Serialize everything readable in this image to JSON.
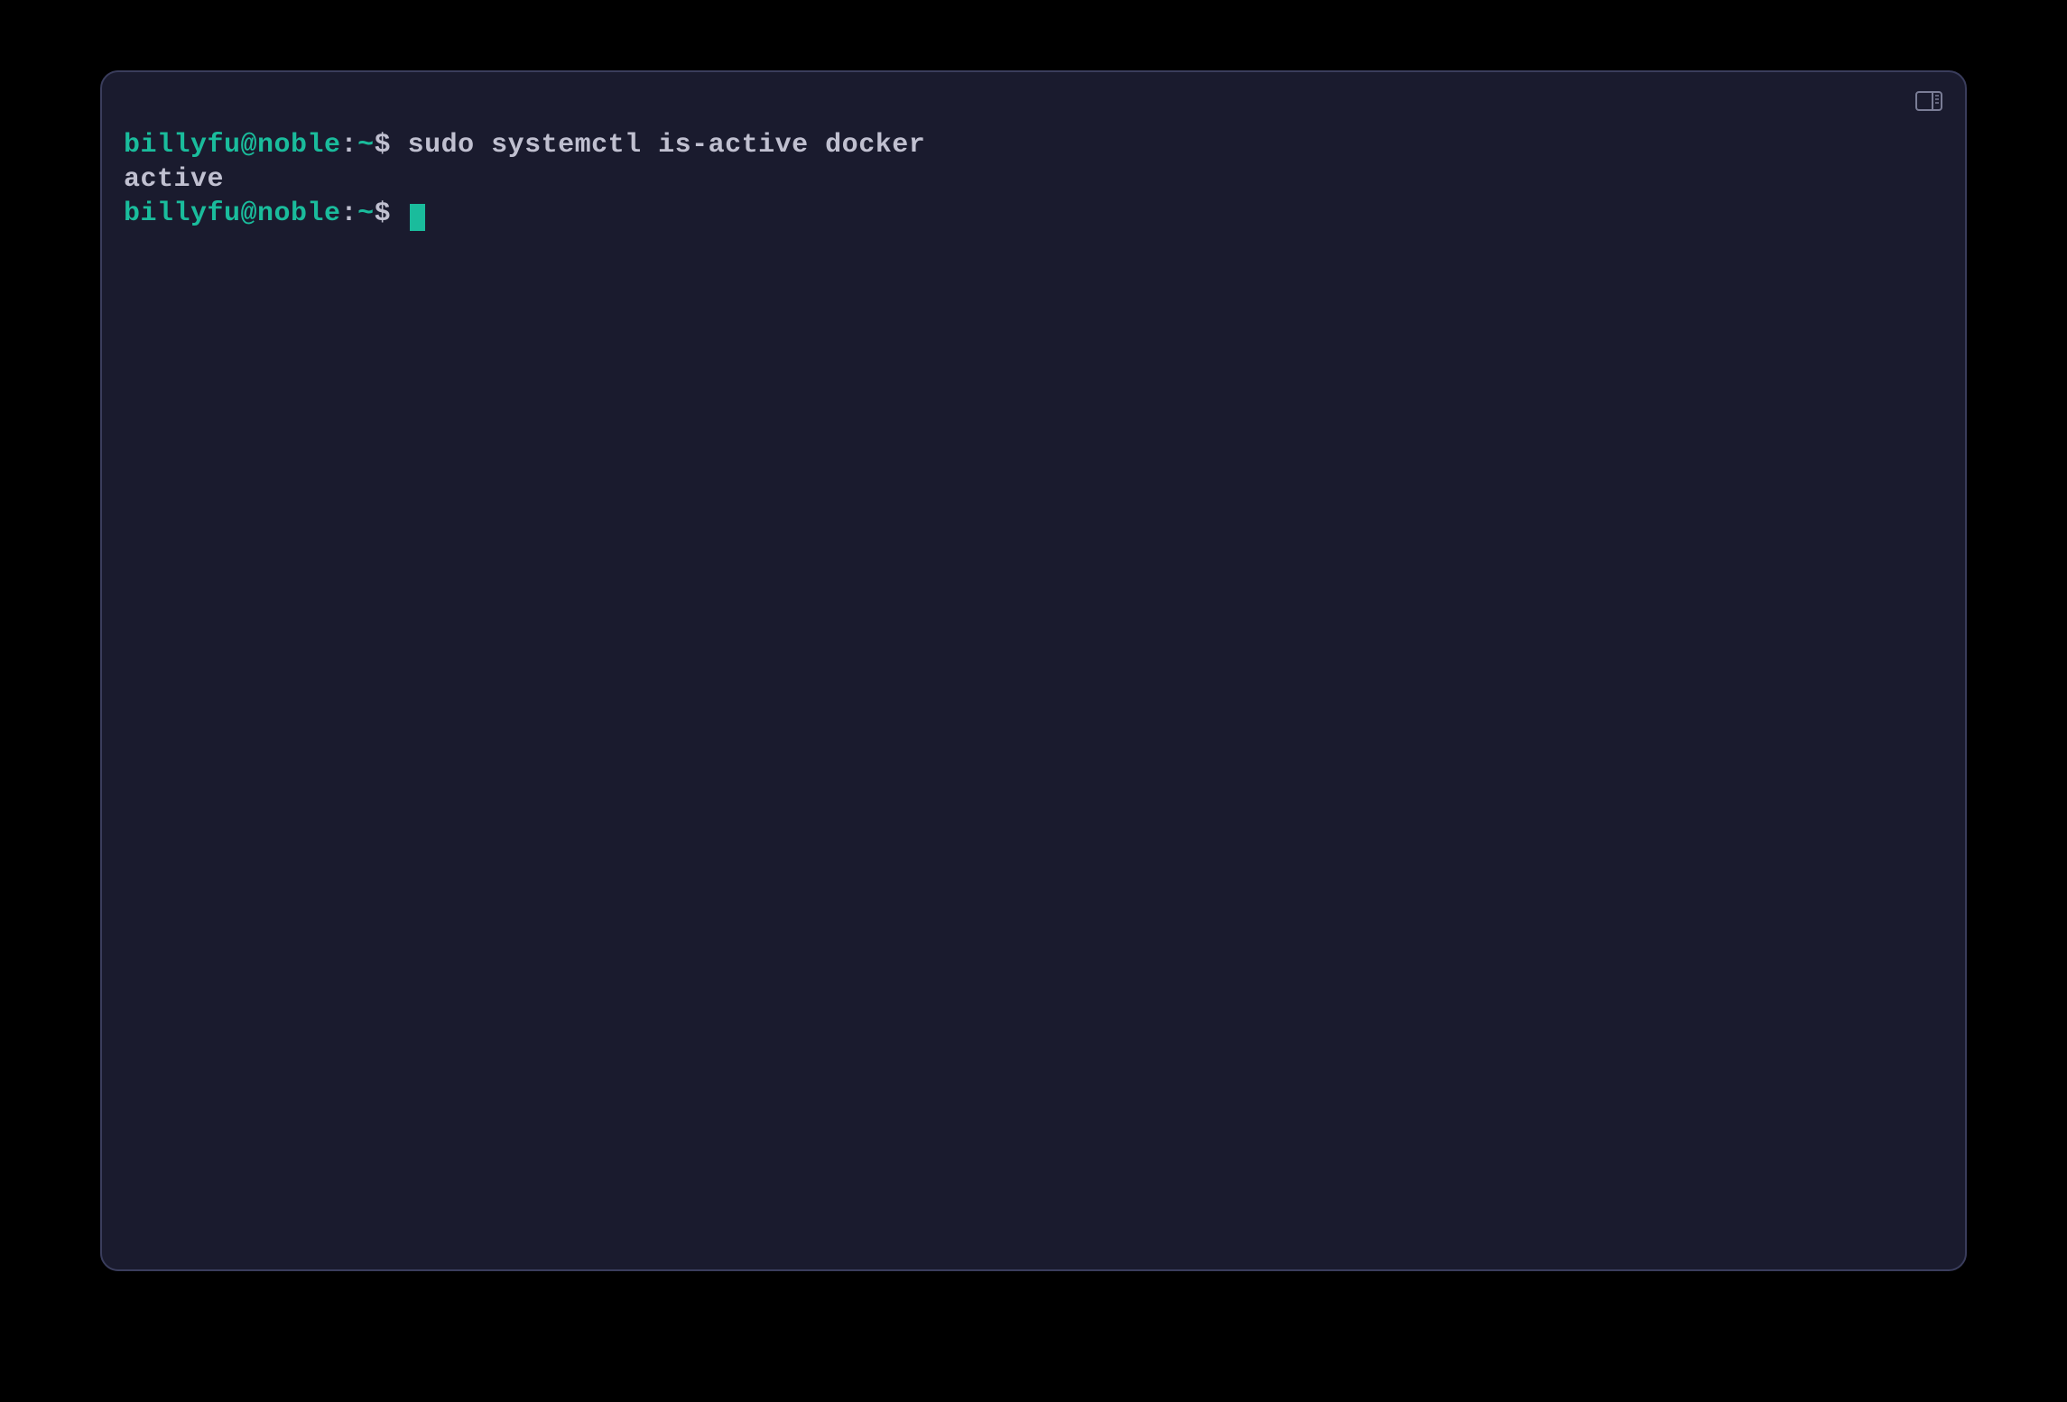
{
  "terminal": {
    "lines": [
      {
        "prompt": {
          "user_host": "billyfu@noble",
          "colon": ":",
          "path": "~",
          "dollar": "$"
        },
        "command": "sudo systemctl is-active docker"
      }
    ],
    "output": [
      "active"
    ],
    "current_prompt": {
      "user_host": "billyfu@noble",
      "colon": ":",
      "path": "~",
      "dollar": "$"
    }
  }
}
